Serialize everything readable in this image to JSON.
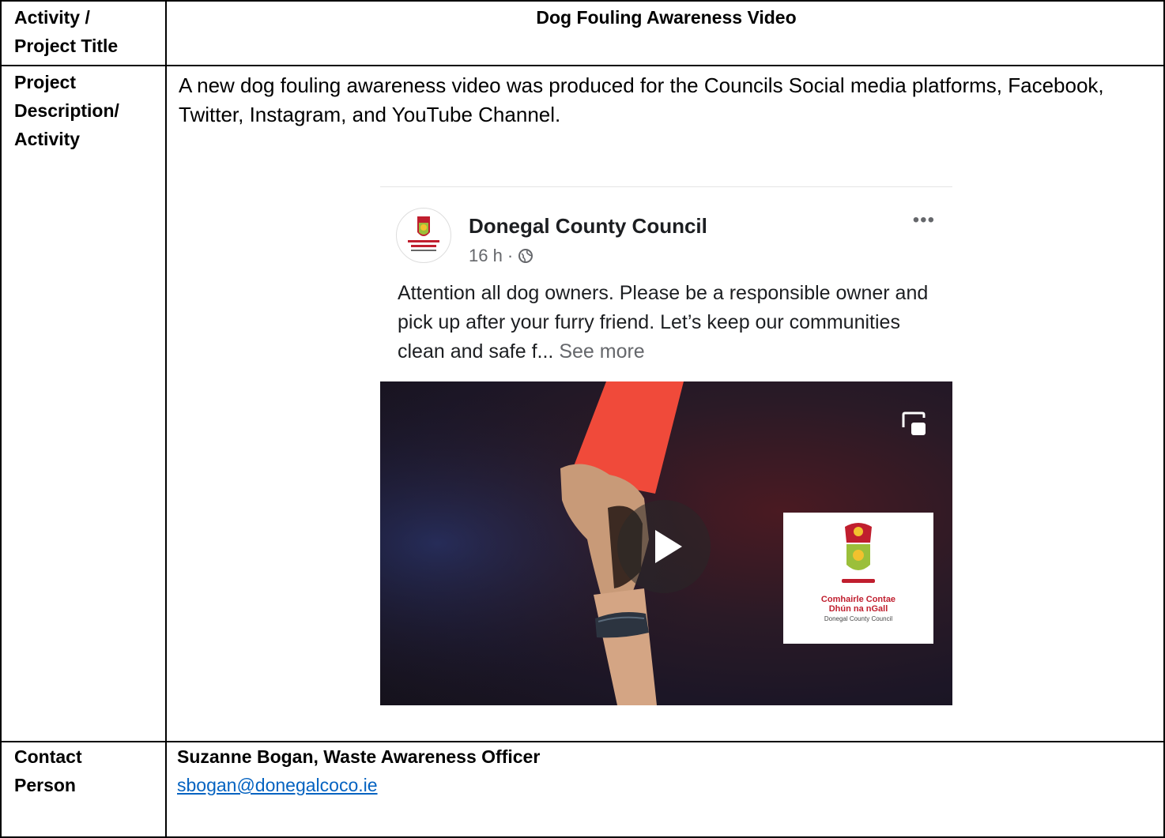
{
  "rows": {
    "title_label": [
      "Activity /",
      "Project Title"
    ],
    "title_value": "Dog Fouling Awareness Video",
    "desc_label": [
      "Project",
      "Description/",
      "Activity"
    ],
    "desc_value": "A new dog fouling awareness video was produced for the Councils Social media platforms, Facebook, Twitter, Instagram, and YouTube Channel.",
    "contact_label": [
      "Contact",
      "Person"
    ],
    "contact_name": "Suzanne Bogan, Waste Awareness Officer",
    "contact_email": "sbogan@donegalcoco.ie"
  },
  "post": {
    "page_name": "Donegal County Council",
    "time": "16 h ·",
    "more_label": "•••",
    "text": "Attention all dog owners. Please be a responsible owner and pick up after your furry friend. Let’s keep our communities clean and safe f...",
    "see_more": "See more",
    "logo_line1": "Comhairle Contae",
    "logo_line2": "Dhún na nGall",
    "logo_line3": "Donegal County Council"
  },
  "colors": {
    "link": "#0563c1",
    "card_red": "#f04a3a",
    "council_red": "#c01e2e"
  },
  "icons": [
    "globe-icon",
    "picture-in-picture-icon",
    "play-icon",
    "more-options-icon",
    "council-crest-icon"
  ]
}
